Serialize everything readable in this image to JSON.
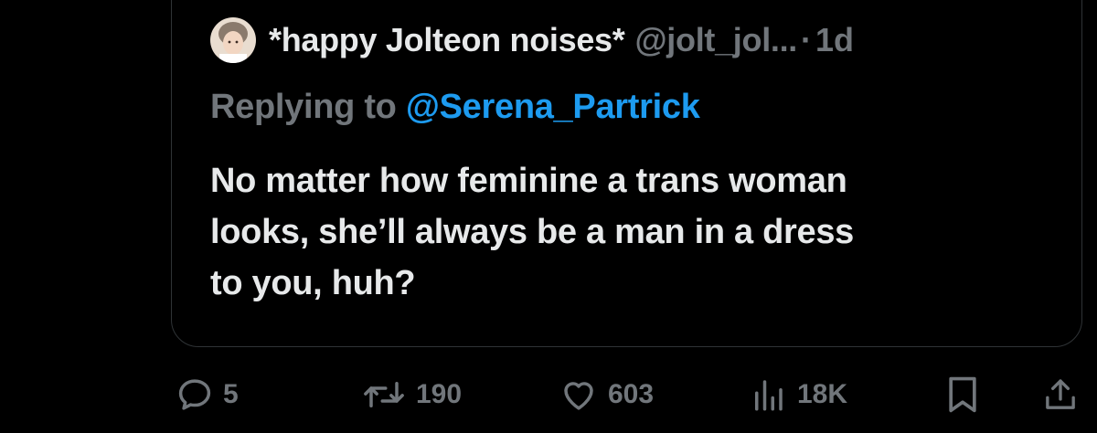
{
  "quoted_tweet": {
    "display_name": "*happy Jolteon noises*",
    "handle": "@jolt_jol...",
    "separator": "·",
    "time": "1d",
    "replying_label": "Replying to",
    "replying_handle": "@Serena_Partrick",
    "text_lines": [
      "No matter how feminine a trans woman",
      "looks, she’ll always be a man in a dress",
      "to you, huh?"
    ]
  },
  "actions": {
    "replies": "5",
    "retweets": "190",
    "likes": "603",
    "views": "18K",
    "icons": [
      "reply-icon",
      "retweet-icon",
      "heart-icon",
      "views-icon",
      "bookmark-icon",
      "share-icon"
    ]
  },
  "colors": {
    "background": "#000000",
    "text": "#e7e9ea",
    "muted": "#71767b",
    "link": "#1d9bf0",
    "border": "#2f3336"
  }
}
